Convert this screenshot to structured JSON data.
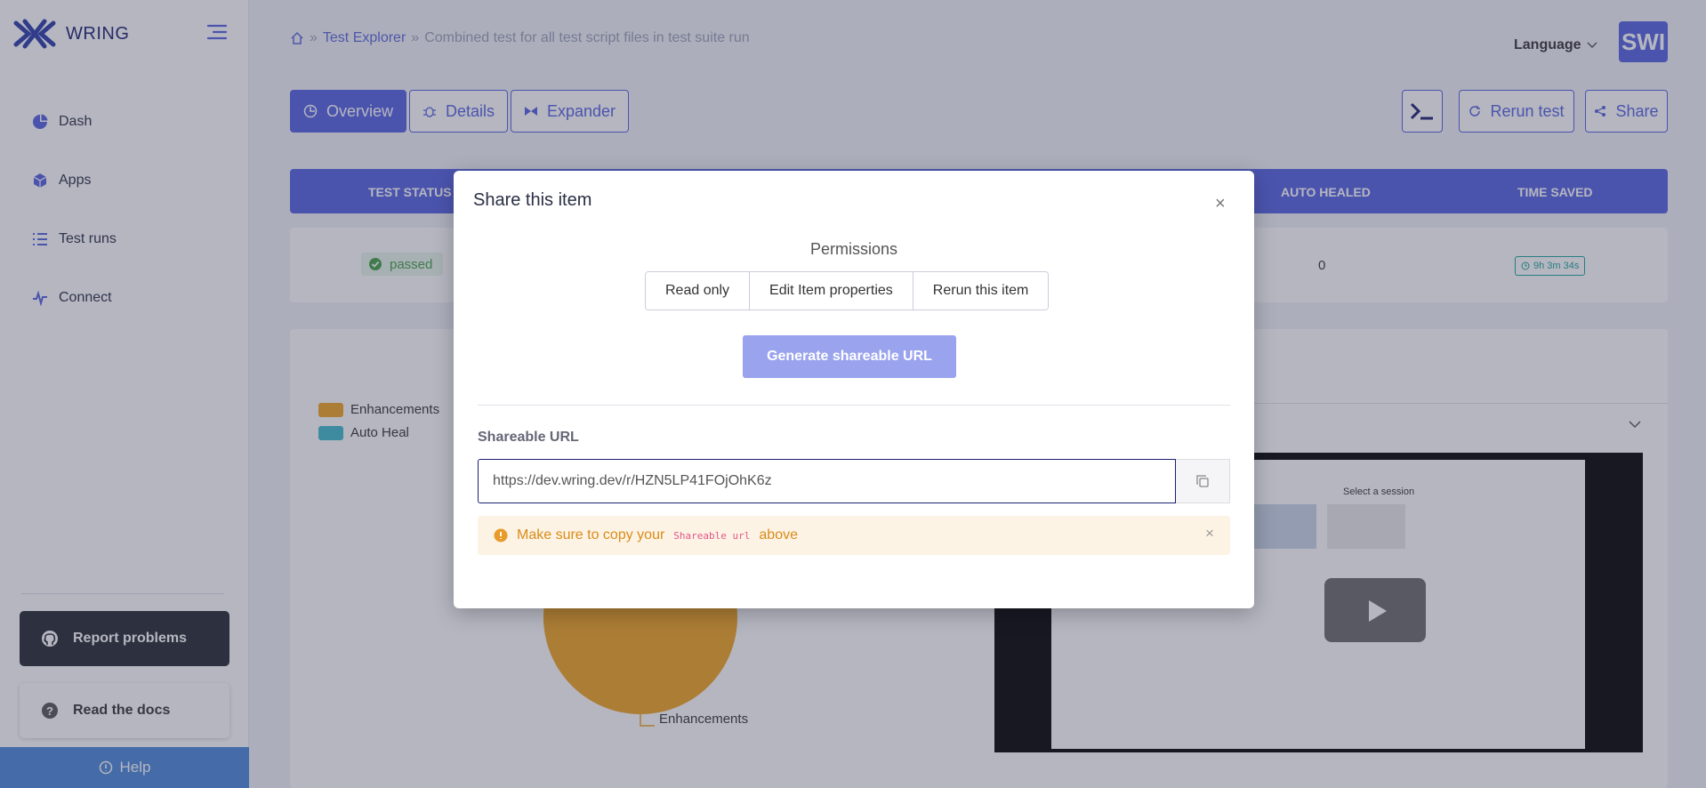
{
  "app": {
    "brand": "WRING",
    "avatar": "SWI",
    "language": "Language"
  },
  "sidebar": {
    "items": [
      {
        "label": "Dash",
        "icon": "pie-icon"
      },
      {
        "label": "Apps",
        "icon": "cube-icon"
      },
      {
        "label": "Test runs",
        "icon": "list-icon"
      },
      {
        "label": "Connect",
        "icon": "pulse-icon"
      }
    ],
    "report": "Report problems",
    "docs": "Read the docs",
    "help": "Help"
  },
  "breadcrumb": {
    "items": [
      "Test Explorer",
      "Combined test for all test script files in test suite run"
    ]
  },
  "tabs": [
    "Overview",
    "Details",
    "Expander"
  ],
  "toolbar": {
    "rerun": "Rerun test",
    "share": "Share"
  },
  "stats": {
    "headers": {
      "status": "TEST STATUS",
      "auto_healed": "AUTO HEALED",
      "time_saved": "TIME SAVED"
    },
    "status": "passed",
    "auto_healed": "0",
    "time_saved": "9h 3m 34s"
  },
  "chart": {
    "legend": [
      {
        "label": "Enhancements",
        "color": "#f0a31f"
      },
      {
        "label": "Auto Heal",
        "color": "#3fb8c9"
      }
    ],
    "slice_label": "Enhancements"
  },
  "video": {
    "screen_title": "Select a session"
  },
  "modal": {
    "title": "Share this item",
    "permissions_title": "Permissions",
    "permissions": [
      "Read only",
      "Edit Item properties",
      "Rerun this item"
    ],
    "generate": "Generate shareable URL",
    "url_label": "Shareable URL",
    "url_value": "https://dev.wring.dev/r/HZN5LP41FOjOhK6z",
    "warn_pre": "Make sure to copy your",
    "warn_code": "Shareable url",
    "warn_post": "above"
  },
  "colors": {
    "primary": "#5561e0",
    "success": "#43a047",
    "warning": "#d98c1a"
  }
}
